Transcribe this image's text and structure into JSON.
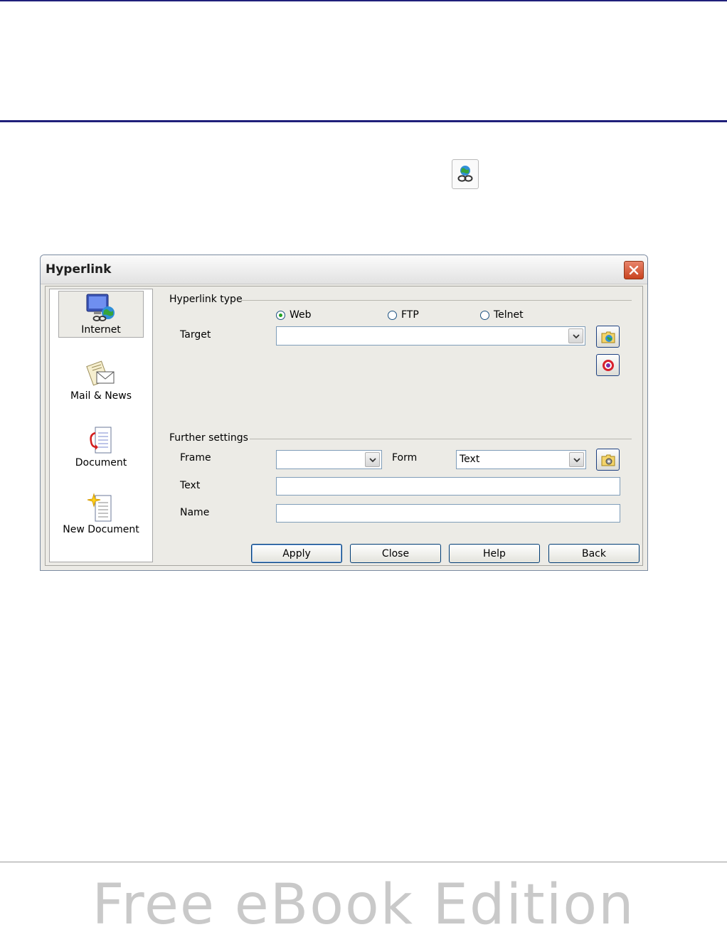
{
  "dialog": {
    "title": "Hyperlink"
  },
  "sidebar": {
    "items": [
      {
        "label": "Internet",
        "icon": "internet-icon",
        "selected": true
      },
      {
        "label": "Mail & News",
        "icon": "mail-news-icon",
        "selected": false
      },
      {
        "label": "Document",
        "icon": "document-icon",
        "selected": false
      },
      {
        "label": "New Document",
        "icon": "new-document-icon",
        "selected": false
      }
    ]
  },
  "hyperlink_type": {
    "group_label": "Hyperlink type",
    "options": [
      {
        "label": "Web",
        "checked": true
      },
      {
        "label": "FTP",
        "checked": false
      },
      {
        "label": "Telnet",
        "checked": false
      }
    ],
    "target_label": "Target",
    "target_value": ""
  },
  "further_settings": {
    "group_label": "Further settings",
    "frame_label": "Frame",
    "frame_value": "",
    "form_label": "Form",
    "form_value": "Text",
    "text_label": "Text",
    "text_value": "",
    "name_label": "Name",
    "name_value": ""
  },
  "buttons": {
    "apply": "Apply",
    "close": "Close",
    "help": "Help",
    "back": "Back"
  },
  "page": {
    "watermark": "Free eBook Edition"
  },
  "colors": {
    "accent": "#1f1f7a",
    "dialog_bg": "#ecebe6",
    "close_button": "#c9431f"
  }
}
